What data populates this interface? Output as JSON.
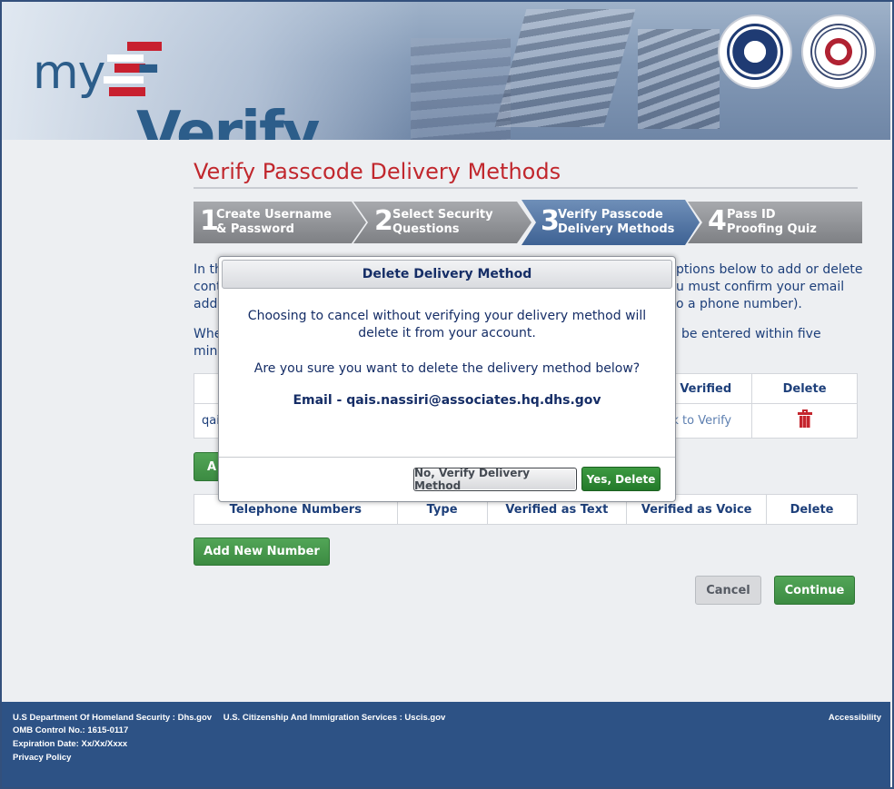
{
  "brand": {
    "my": "my",
    "verify": "-Verify",
    "seal_dhs": "U.S. Department of Homeland Security",
    "seal_ssa": "Social Security Administration USA"
  },
  "colors": {
    "accent_red": "#c1272d",
    "brand_blue": "#2c5d8a",
    "action_green": "#3c8b42",
    "footer_blue": "#2d5285"
  },
  "page": {
    "title": "Verify Passcode Delivery Methods"
  },
  "steps": [
    {
      "num": "1",
      "line1": "Create Username",
      "line2": "& Password",
      "active": false
    },
    {
      "num": "2",
      "line1": "Select Security",
      "line2": "Questions",
      "active": false
    },
    {
      "num": "3",
      "line1": "Verify Passcode",
      "line2": "Delivery Methods",
      "active": true
    },
    {
      "num": "4",
      "line1": "Pass ID",
      "line2": "Proofing Quiz",
      "active": false
    }
  ],
  "intro": {
    "left_l1": "In th",
    "left_l2": "cont",
    "left_l3": "add",
    "right_l1": "ptions below to add or delete",
    "right_l2": "u must confirm your email",
    "right_l3": "o a phone number).",
    "when_left_l1": "Whe",
    "when_left_l2": "minu",
    "when_right": "be entered within five"
  },
  "email_table": {
    "col_verified": "Verified",
    "col_delete": "Delete",
    "row_email_partial": "qai",
    "row_verify_partial": "k to Verify"
  },
  "add_email_partial": "A",
  "phone_table": {
    "headers": [
      "Telephone Numbers",
      "Type",
      "Verified as Text",
      "Verified as Voice",
      "Delete"
    ]
  },
  "buttons": {
    "add_number": "Add New Number",
    "cancel": "Cancel",
    "continue": "Continue"
  },
  "modal": {
    "title": "Delete Delivery Method",
    "message1_l1": "Choosing to cancel without verifying your delivery method will",
    "message1_l2": "delete it from your account.",
    "message2": "Are you sure you want to delete the delivery method below?",
    "email": "Email - qais.nassiri@associates.hq.dhs.gov",
    "no_button": "No, Verify Delivery Method",
    "yes_button": "Yes, Delete"
  },
  "footer": {
    "dhs": "U.S Department Of Homeland Security : Dhs.gov",
    "uscis": "U.S. Citizenship And Immigration Services : Uscis.gov",
    "omb": "OMB Control No.: 1615-0117",
    "expiration": "Expiration Date: Xx/Xx/Xxxx",
    "privacy": "Privacy Policy",
    "accessibility": "Accessibility"
  }
}
